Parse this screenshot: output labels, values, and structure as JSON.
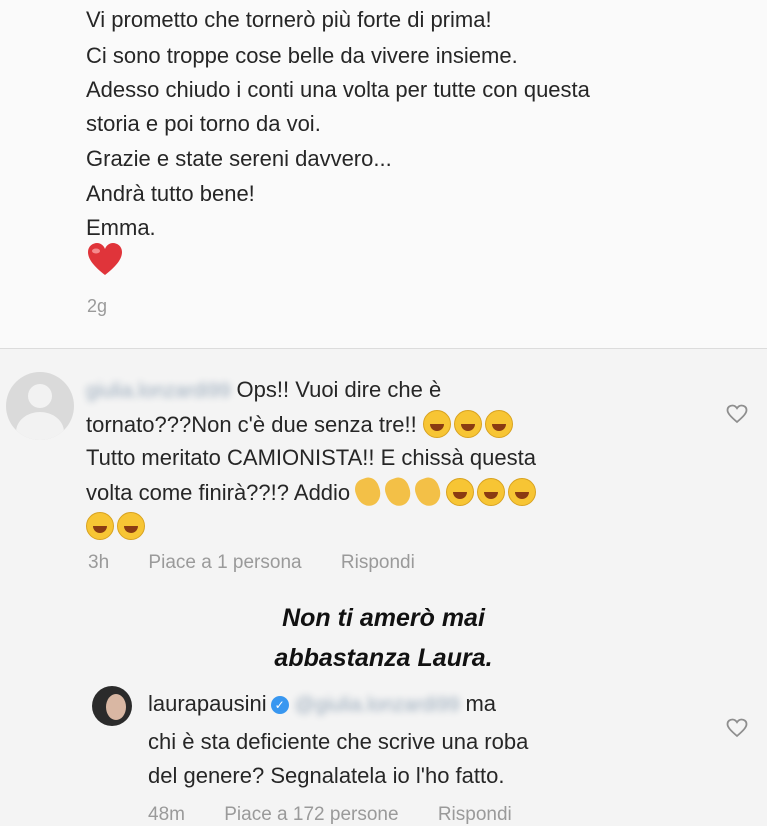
{
  "post": {
    "caption_lines": [
      "Vi prometto che tornerò più forte di prima!",
      "Ci sono troppe cose belle da vivere insieme.",
      "Adesso chiudo i conti una volta per tutte  con questa",
      "storia e poi torno da voi.",
      "Grazie e state sereni davvero...",
      "Andrà tutto bene!",
      "Emma."
    ],
    "time": "2g"
  },
  "comment1": {
    "username": "giulia.lonzardi99",
    "text_line1": "Ops!! Vuoi dire che è",
    "text_line2": "tornato???Non c'è due senza tre!!",
    "text_line3": "Tutto meritato CAMIONISTA!! E chissà questa",
    "text_line4": "volta come finirà??!? Addio",
    "time": "3h",
    "likes": "Piace a 1 persona",
    "reply": "Rispondi"
  },
  "overlay": {
    "line1": "Non ti amerò mai",
    "line2": "abbastanza Laura."
  },
  "comment2": {
    "username": "laurapausini",
    "mention": "@giulia.lonzardi99",
    "text_line1_end": "ma",
    "text_line2": "chi è sta deficiente che scrive una roba",
    "text_line3": "del genere? Segnalatela io l'ho fatto.",
    "time": "48m",
    "likes": "Piace a 172 persone",
    "reply": "Rispondi"
  },
  "colors": {
    "text": "#262626",
    "muted": "#9a9a9a",
    "verified": "#3897f0",
    "heart": "#e0343a"
  },
  "icons": [
    "heart-emoji",
    "laugh-emoji",
    "clap-emoji",
    "like-heart-icon",
    "verified-badge-icon",
    "default-avatar-icon"
  ]
}
